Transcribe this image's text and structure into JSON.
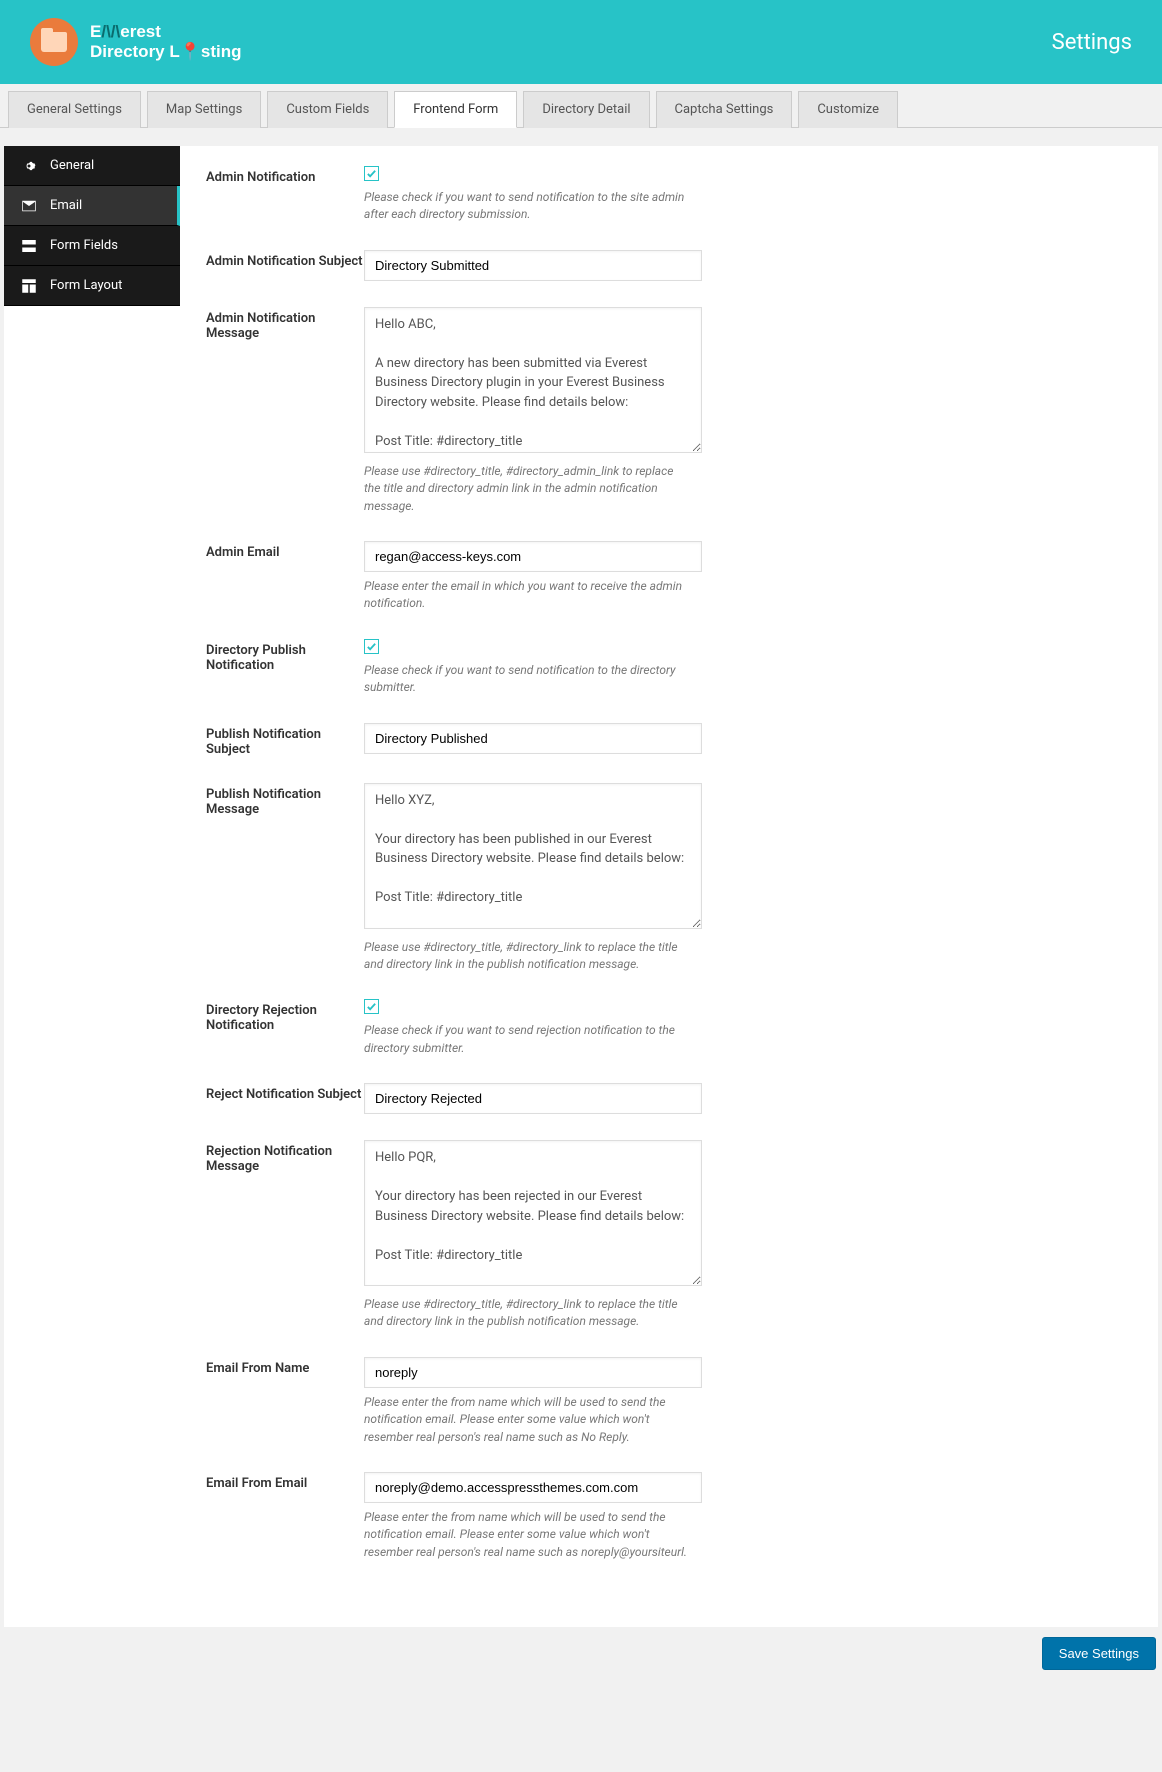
{
  "header": {
    "title": "Settings",
    "brand_line1": "Everest",
    "brand_line2": "Directory Listing"
  },
  "tabs": [
    {
      "label": "General Settings"
    },
    {
      "label": "Map Settings"
    },
    {
      "label": "Custom Fields"
    },
    {
      "label": "Frontend Form",
      "active": true
    },
    {
      "label": "Directory Detail"
    },
    {
      "label": "Captcha Settings"
    },
    {
      "label": "Customize"
    }
  ],
  "side": [
    {
      "label": "General"
    },
    {
      "label": "Email",
      "active": true
    },
    {
      "label": "Form Fields"
    },
    {
      "label": "Form Layout"
    }
  ],
  "labels": {
    "admin_notif": "Admin Notification",
    "admin_subj": "Admin Notification Subject",
    "admin_msg": "Admin Notification Message",
    "admin_email": "Admin Email",
    "dir_pub_notif": "Directory Publish Notification",
    "pub_subj": "Publish Notification Subject",
    "pub_msg": "Publish Notification Message",
    "dir_rej_notif": "Directory Rejection Notification",
    "rej_subj": "Reject Notification Subject",
    "rej_msg": "Rejection Notification Message",
    "from_name": "Email From Name",
    "from_email": "Email From Email"
  },
  "values": {
    "admin_subj": "Directory Submitted",
    "admin_msg": "Hello ABC,\n\nA new directory has been submitted via Everest Business Directory plugin in your Everest Business Directory website. Please find details below:\n\nPost Title: #directory_title\n\n_____",
    "admin_email": "regan@access-keys.com",
    "pub_subj": "Directory Published",
    "pub_msg": "Hello XYZ,\n\nYour directory has been published in our Everest Business Directory website. Please find details below:\n\nPost Title: #directory_title\n\n_____\n\nTo take action (approve/reject) - please go here:",
    "rej_subj": "Directory Rejected",
    "rej_msg": "Hello PQR,\n\nYour directory has been rejected in our Everest Business Directory website. Please find details below:\n\nPost Title: #directory_title\n\nThank you",
    "from_name": "noreply",
    "from_email": "noreply@demo.accesspressthemes.com.com"
  },
  "help": {
    "admin_notif": "Please check if you want to send notification to the site admin after each directory submission.",
    "admin_msg": "Please use #directory_title, #directory_admin_link to replace the title and directory admin link in the admin notification message.",
    "admin_email": "Please enter the email in which you want to receive the admin notification.",
    "dir_pub_notif": "Please check if you want to send notification to the directory submitter.",
    "pub_msg": "Please use #directory_title, #directory_link to replace the title and directory link in the publish notification message.",
    "dir_rej_notif": "Please check if you want to send rejection notification to the directory submitter.",
    "rej_msg": "Please use #directory_title, #directory_link to replace the title and directory link in the publish notification message.",
    "from_name": "Please enter the from name which will be used to send the notification email. Please enter some value which won't resember real person's real name such as No Reply.",
    "from_email": "Please enter the from name which will be used to send the notification email. Please enter some value which won't resember real person's real name such as noreply@yoursiteurl."
  },
  "buttons": {
    "save": "Save Settings"
  }
}
